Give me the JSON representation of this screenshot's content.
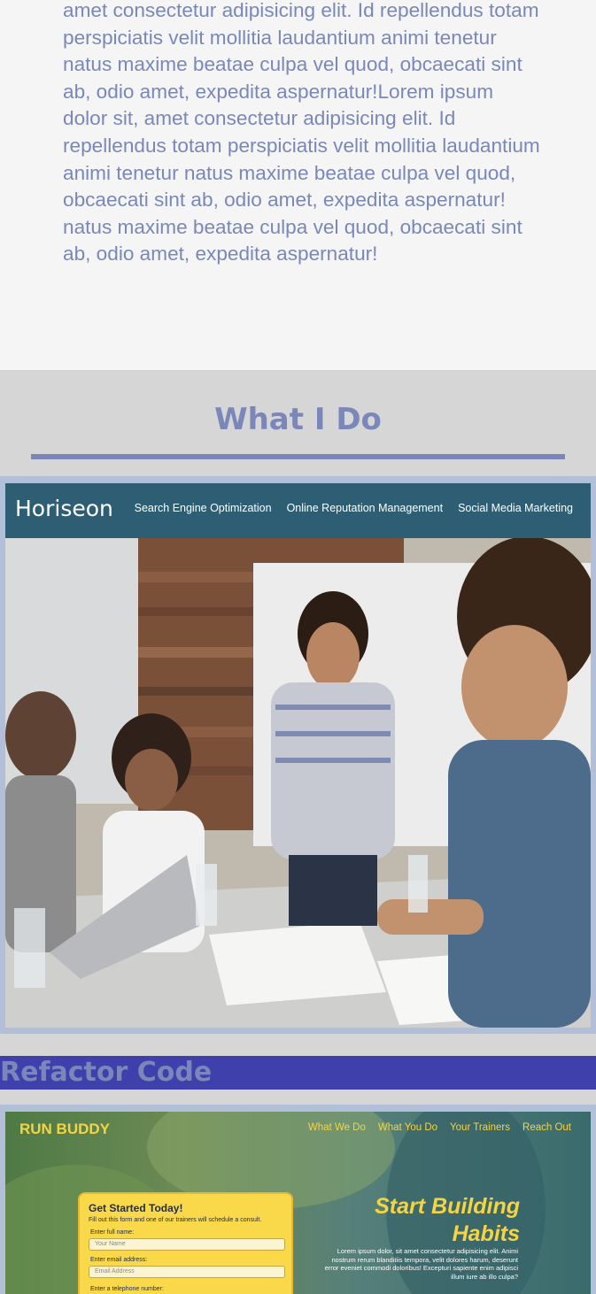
{
  "about": {
    "body": "amet consectetur adipisicing elit. Id repellendus totam perspiciatis velit mollitia laudantium animi tenetur natus maxime beatae culpa vel quod, obcaecati sint ab, odio amet, expedita aspernatur!Lorem ipsum dolor sit, amet consectetur adipisicing elit. Id repellendus totam perspiciatis velit mollitia laudantium animi tenetur natus maxime beatae culpa vel quod, obcaecati sint ab, odio amet, expedita aspernatur! natus maxime beatae culpa vel quod, obcaecati sint ab, odio amet, expedita aspernatur!"
  },
  "section": {
    "title": "What I Do"
  },
  "projects": [
    {
      "screenshot": {
        "brand": "Horiseon",
        "nav": [
          "Search Engine Optimization",
          "Online Reputation Management",
          "Social Media Marketing"
        ]
      }
    },
    {
      "title": "Refactor Code",
      "screenshot": {
        "brand": "RUN BUDDY",
        "nav": [
          "What We Do",
          "What You Do",
          "Your Trainers",
          "Reach Out"
        ],
        "form_title": "Get Started Today!",
        "form_subtitle": "Fill out this form and one of our trainers will schedule a consult.",
        "name_label": "Enter full name:",
        "name_placeholder": "Your Name",
        "email_label": "Enter email address:",
        "email_placeholder": "Email Address",
        "phone_label": "Enter a telephone number:",
        "hero_line1": "Start Building",
        "hero_line2": "Habits",
        "hero_text": "Lorem ipsum dolor, sit amet consectetur adipisicing elit. Animi nostrum rerum blanditiis tempora, velit dolores harum, deserunt error eveniet commodi doloribus! Excepturi sapiente enim adipisci illum iure ab illo culpa?"
      }
    }
  ],
  "colors": {
    "accent": "#7b87b8",
    "refactor_bar": "#4040ad",
    "card_border": "#b1bfd9"
  }
}
